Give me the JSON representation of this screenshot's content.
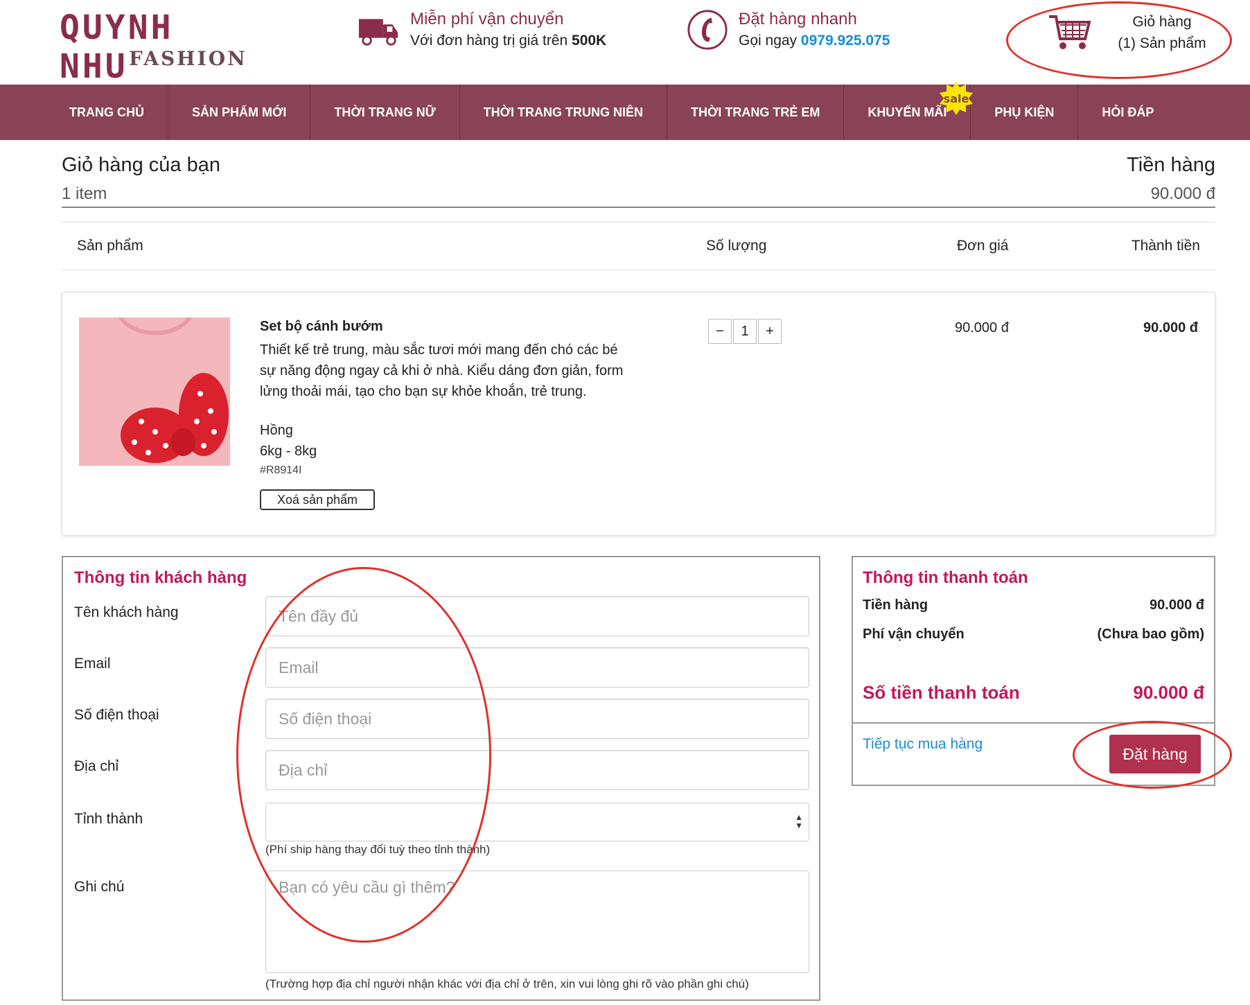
{
  "header": {
    "logo_line1": "QUYNH NHU",
    "logo_line2": "FASHION",
    "shipping_title": "Miễn phí vận chuyển",
    "shipping_text": "Với đơn hàng trị giá trên",
    "shipping_amount": "500K",
    "order_title": "Đặt hàng nhanh",
    "order_text": "Gọi ngay",
    "order_phone": "0979.925.075",
    "cart_title": "Giỏ hàng",
    "cart_count": "(1) Sản phẩm"
  },
  "nav": {
    "items": [
      "TRANG CHỦ",
      "SẢN PHẨM MỚI",
      "THỜI TRANG NỮ",
      "THỜI TRANG TRUNG NIÊN",
      "THỜI TRANG TRẺ EM",
      "KHUYẾN MÃI",
      "PHỤ KIỆN",
      "HỎI ĐÁP"
    ],
    "sale_badge": "sale"
  },
  "cart": {
    "title": "Giỏ hàng của bạn",
    "item_count": "1 item",
    "money_title": "Tiền hàng",
    "money_value": "90.000 đ",
    "columns": {
      "product": "Sản phẩm",
      "quantity": "Số lượng",
      "unit_price": "Đơn giá",
      "total": "Thành tiền"
    },
    "product": {
      "name": "Set bộ cánh bướm",
      "description": "Thiết kế trẻ trung, màu sắc tươi mới mang đến chó các bé sự năng động ngay cả khi ở nhà. Kiểu dáng đơn giản, form lửng thoải mái, tạo cho bạn sự khỏe khoắn, trẻ trung.",
      "color": "Hồng",
      "size": "6kg - 8kg",
      "sku": "#R8914I",
      "delete_label": "Xoá sản phẩm",
      "qty_minus": "−",
      "qty_value": "1",
      "qty_plus": "+",
      "unit_price": "90.000 đ",
      "line_total": "90.000 đ"
    }
  },
  "customer": {
    "title": "Thông tin khách hàng",
    "name_label": "Tên khách hàng",
    "name_placeholder": "Tên đầy đủ",
    "email_label": "Email",
    "email_placeholder": "Email",
    "phone_label": "Số điện thoại",
    "phone_placeholder": "Số điện thoại",
    "address_label": "Địa chỉ",
    "address_placeholder": "Địa chỉ",
    "province_label": "Tỉnh thành",
    "province_hint": "(Phí ship hàng thay đổi tuỳ theo tỉnh thành)",
    "note_label": "Ghi chú",
    "note_placeholder": "Bạn có yêu cầu gì thêm?",
    "note_hint": "(Trường hợp địa chỉ người nhận khác với địa chỉ ở trên, xin vui lòng ghi rõ vào phần ghi chú)"
  },
  "payment": {
    "title": "Thông tin thanh toán",
    "goods_label": "Tiền hàng",
    "goods_value": "90.000 đ",
    "shipping_label": "Phí vận chuyển",
    "shipping_value": "(Chưa bao gồm)",
    "total_label": "Số tiền thanh toán",
    "total_value": "90.000 đ",
    "continue_label": "Tiếp tục mua hàng",
    "order_button": "Đặt hàng"
  },
  "colors": {
    "nav_bg": "#8a4356",
    "accent": "#c2185b",
    "button": "#b0304f",
    "link": "#1a8bd8",
    "annotation": "#e0302a"
  }
}
